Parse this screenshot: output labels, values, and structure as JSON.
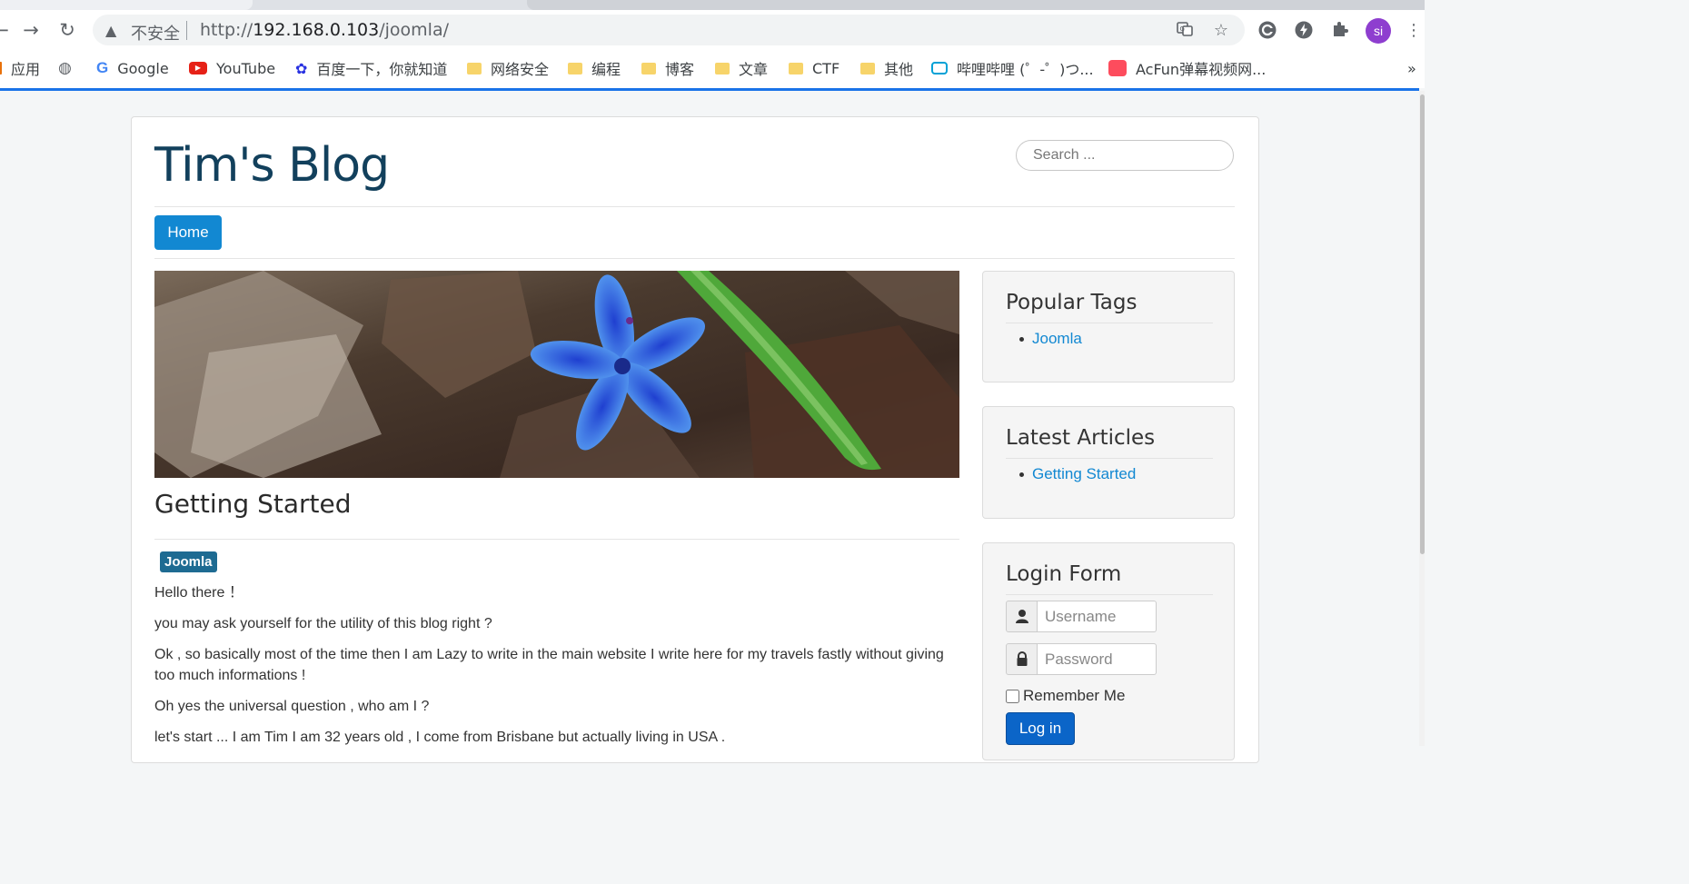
{
  "browser": {
    "insecure_label": "不安全",
    "url_prefix": "http://",
    "url_host": "192.168.0.103",
    "url_path": "/joomla/",
    "avatar_initials": "si",
    "accent_color": "#1a73e8",
    "icons": [
      "back-arrow-icon",
      "forward-arrow-icon",
      "reload-icon",
      "warning-icon",
      "translate-icon",
      "star-icon",
      "extension-c-icon",
      "lightning-icon",
      "puzzle-icon",
      "menu-dots-icon"
    ]
  },
  "bookmarks": [
    {
      "label": "应用",
      "icon": "apps-icon"
    },
    {
      "label": "",
      "icon": "globe-icon"
    },
    {
      "label": "Google",
      "icon": "google-icon"
    },
    {
      "label": "YouTube",
      "icon": "youtube-icon"
    },
    {
      "label": "百度一下，你就知道",
      "icon": "baidu-icon"
    },
    {
      "label": "网络安全",
      "icon": "folder-icon"
    },
    {
      "label": "编程",
      "icon": "folder-icon"
    },
    {
      "label": "博客",
      "icon": "folder-icon"
    },
    {
      "label": "文章",
      "icon": "folder-icon"
    },
    {
      "label": "CTF",
      "icon": "folder-icon"
    },
    {
      "label": "其他",
      "icon": "folder-icon"
    },
    {
      "label": "哔哩哔哩 (゜-゜)つ...",
      "icon": "bilibili-icon"
    },
    {
      "label": "AcFun弹幕视频网...",
      "icon": "acfun-icon"
    }
  ],
  "bookmarks_more": "»",
  "site": {
    "brand": "Tim's Blog",
    "brand_color": "#12405c",
    "search_placeholder": "Search ...",
    "nav": {
      "home_label": "Home"
    }
  },
  "article": {
    "title": "Getting Started",
    "tag": "Joomla",
    "paragraphs": [
      "Hello there ！",
      "you may ask yourself for the utility of this blog right ?",
      "Ok , so basically most of  the time then I am Lazy to write in the main website I write here for my travels fastly without giving too much informations !",
      "Oh yes the universal question , who am I ?",
      "let's start ... I am Tim I am 32 years old ,  I come from Brisbane but actually living in USA ."
    ]
  },
  "sidebar": {
    "popular_tags": {
      "title": "Popular Tags",
      "items": [
        "Joomla"
      ]
    },
    "latest_articles": {
      "title": "Latest Articles",
      "items": [
        "Getting Started"
      ]
    },
    "login": {
      "title": "Login Form",
      "username_placeholder": "Username",
      "password_placeholder": "Password",
      "remember_label": "Remember Me",
      "button_label": "Log in"
    }
  }
}
